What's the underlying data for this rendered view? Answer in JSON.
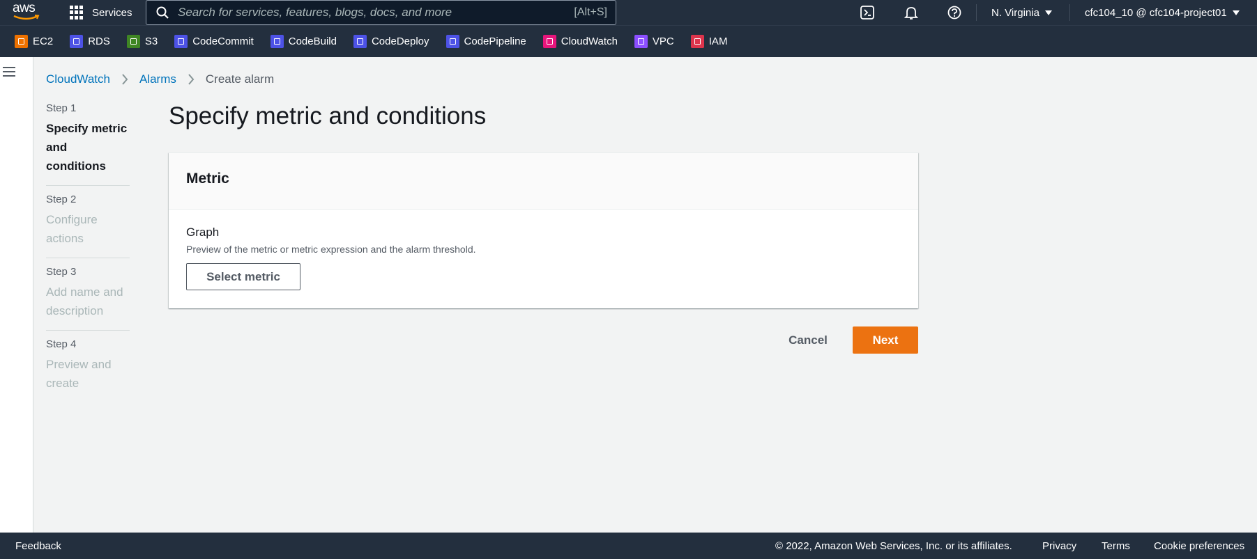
{
  "topnav": {
    "logo_text": "aws",
    "services_label": "Services",
    "search_placeholder": "Search for services, features, blogs, docs, and more",
    "search_shortcut": "[Alt+S]",
    "region": "N. Virginia",
    "account": "cfc104_10 @ cfc104-project01"
  },
  "favorites": [
    {
      "label": "EC2",
      "color": "#ed7100"
    },
    {
      "label": "RDS",
      "color": "#4d52e6"
    },
    {
      "label": "S3",
      "color": "#3f8624"
    },
    {
      "label": "CodeCommit",
      "color": "#4d52e6"
    },
    {
      "label": "CodeBuild",
      "color": "#4d52e6"
    },
    {
      "label": "CodeDeploy",
      "color": "#4d52e6"
    },
    {
      "label": "CodePipeline",
      "color": "#4d52e6"
    },
    {
      "label": "CloudWatch",
      "color": "#e7157b"
    },
    {
      "label": "VPC",
      "color": "#8c4fff"
    },
    {
      "label": "IAM",
      "color": "#dd344c"
    }
  ],
  "breadcrumb": {
    "items": [
      "CloudWatch",
      "Alarms"
    ],
    "current": "Create alarm"
  },
  "steps": [
    {
      "num": "Step 1",
      "title": "Specify metric and conditions",
      "active": true
    },
    {
      "num": "Step 2",
      "title": "Configure actions",
      "active": false
    },
    {
      "num": "Step 3",
      "title": "Add name and description",
      "active": false
    },
    {
      "num": "Step 4",
      "title": "Preview and create",
      "active": false
    }
  ],
  "main": {
    "title": "Specify metric and conditions",
    "container_header": "Metric",
    "graph_label": "Graph",
    "graph_desc": "Preview of the metric or metric expression and the alarm threshold.",
    "select_metric": "Select metric",
    "cancel": "Cancel",
    "next": "Next"
  },
  "footer": {
    "feedback": "Feedback",
    "copyright": "© 2022, Amazon Web Services, Inc. or its affiliates.",
    "privacy": "Privacy",
    "terms": "Terms",
    "cookies": "Cookie preferences"
  },
  "colors": {
    "nav_bg": "#232f3e",
    "link": "#0073bb",
    "primary_button": "#ec7211"
  }
}
